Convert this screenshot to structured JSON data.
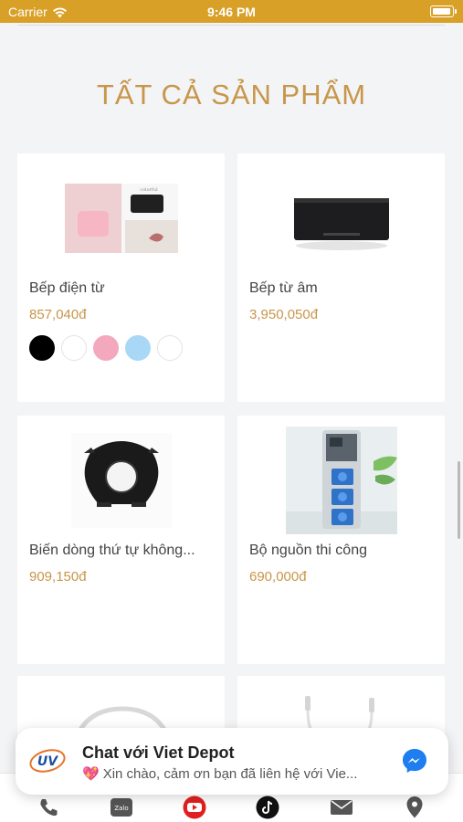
{
  "status_bar": {
    "carrier": "Carrier",
    "time": "9:46 PM"
  },
  "section": {
    "title": "TẤT CẢ SẢN PHẨM"
  },
  "products": [
    {
      "name": "Bếp điện từ",
      "price": "857,040đ",
      "swatches": [
        "#000000",
        "#ffffff",
        "#f4a8bd",
        "#a9d8f6",
        "#ffffff"
      ]
    },
    {
      "name": "Bếp từ âm",
      "price": "3,950,050đ"
    },
    {
      "name": "Biến dòng thứ tự không...",
      "price": "909,150đ"
    },
    {
      "name": "Bộ nguồn thi công",
      "price": "690,000đ"
    }
  ],
  "chat": {
    "logo_text": "UV",
    "title": "Chat với Viet Depot",
    "message": "Xin chào, cảm ơn bạn đã liên hệ với Vie..."
  },
  "colors": {
    "accent": "#d9a027",
    "gold_text": "#c8964a",
    "messenger": "#1e7ef0"
  },
  "bottom_nav_icons": [
    "phone-icon",
    "zalo-icon",
    "youtube-icon",
    "tiktok-icon",
    "mail-icon",
    "location-icon"
  ]
}
